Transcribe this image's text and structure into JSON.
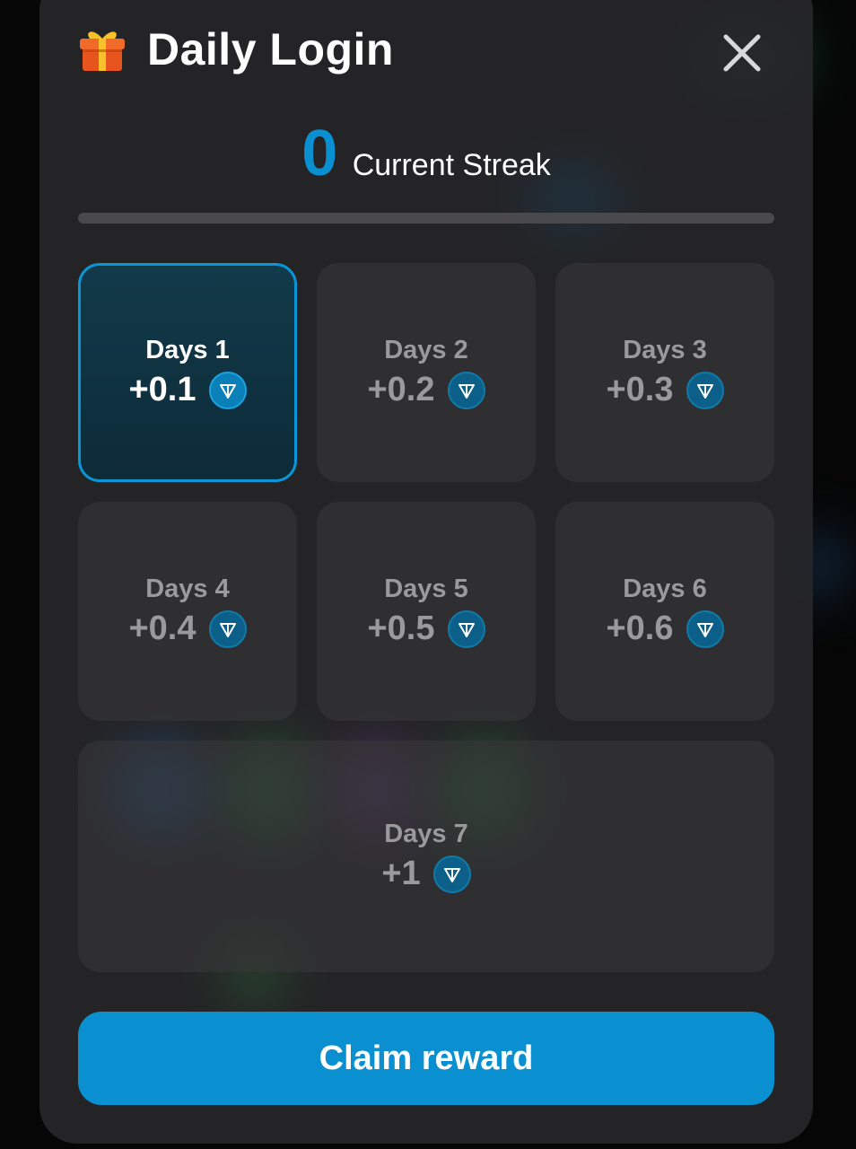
{
  "modal": {
    "title": "Daily Login",
    "gift_icon": "gift-icon",
    "close_icon": "close-icon"
  },
  "streak": {
    "value": "0",
    "label": "Current Streak",
    "progress": 0
  },
  "days": [
    {
      "label": "Days 1",
      "reward": "+0.1",
      "active": true
    },
    {
      "label": "Days 2",
      "reward": "+0.2",
      "active": false
    },
    {
      "label": "Days 3",
      "reward": "+0.3",
      "active": false
    },
    {
      "label": "Days 4",
      "reward": "+0.4",
      "active": false
    },
    {
      "label": "Days 5",
      "reward": "+0.5",
      "active": false
    },
    {
      "label": "Days 6",
      "reward": "+0.6",
      "active": false
    },
    {
      "label": "Days 7",
      "reward": "+1",
      "active": false
    }
  ],
  "coin_icon": "ton-coin-icon",
  "claim_button": "Claim reward",
  "colors": {
    "accent": "#0a8fd0",
    "modal_bg": "#262628",
    "card_bg": "#333335",
    "muted_text": "#9a9a9c"
  }
}
